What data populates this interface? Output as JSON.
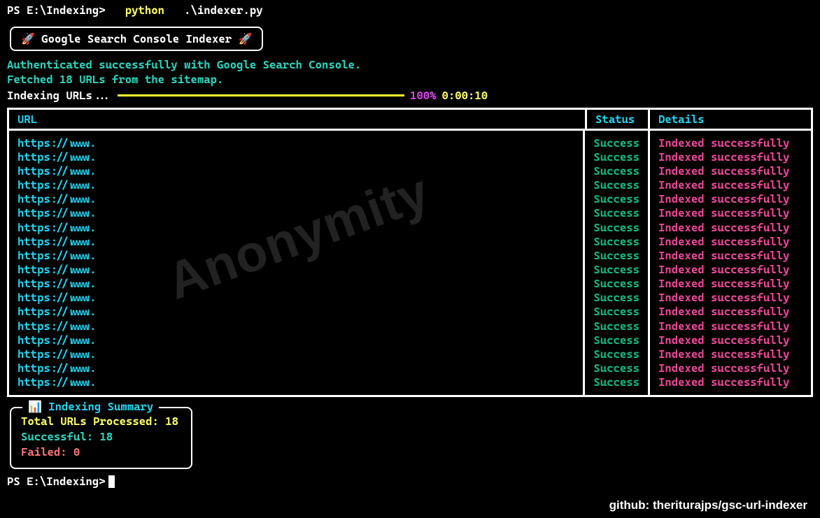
{
  "prompt": {
    "prefix": "PS E:\\Indexing>",
    "command": "python",
    "arg": ".\\indexer.py"
  },
  "title": "Google Search Console Indexer",
  "auth_lines": {
    "line1": "Authenticated successfully with Google Search Console.",
    "line2": "Fetched 18 URLs from the sitemap."
  },
  "progress": {
    "label": "Indexing URLs...",
    "percent": "100%",
    "time": "0:00:10"
  },
  "table": {
    "headers": {
      "url": "URL",
      "status": "Status",
      "details": "Details"
    },
    "rows": [
      {
        "url": "https://www.",
        "status": "Success",
        "details": "Indexed successfully"
      },
      {
        "url": "https://www.",
        "status": "Success",
        "details": "Indexed successfully"
      },
      {
        "url": "https://www.",
        "status": "Success",
        "details": "Indexed successfully"
      },
      {
        "url": "https://www.",
        "status": "Success",
        "details": "Indexed successfully"
      },
      {
        "url": "https://www.",
        "status": "Success",
        "details": "Indexed successfully"
      },
      {
        "url": "https://www.",
        "status": "Success",
        "details": "Indexed successfully"
      },
      {
        "url": "https://www.",
        "status": "Success",
        "details": "Indexed successfully"
      },
      {
        "url": "https://www.",
        "status": "Success",
        "details": "Indexed successfully"
      },
      {
        "url": "https://www.",
        "status": "Success",
        "details": "Indexed successfully"
      },
      {
        "url": "https://www.",
        "status": "Success",
        "details": "Indexed successfully"
      },
      {
        "url": "https://www.",
        "status": "Success",
        "details": "Indexed successfully"
      },
      {
        "url": "https://www.",
        "status": "Success",
        "details": "Indexed successfully"
      },
      {
        "url": "https://www.",
        "status": "Success",
        "details": "Indexed successfully"
      },
      {
        "url": "https://www.",
        "status": "Success",
        "details": "Indexed successfully"
      },
      {
        "url": "https://www.",
        "status": "Success",
        "details": "Indexed successfully"
      },
      {
        "url": "https://www.",
        "status": "Success",
        "details": "Indexed successfully"
      },
      {
        "url": "https://www.",
        "status": "Success",
        "details": "Indexed successfully"
      },
      {
        "url": "https://www.",
        "status": "Success",
        "details": "Indexed successfully"
      }
    ]
  },
  "watermark": "Anonymity",
  "summary": {
    "title": "Indexing Summary",
    "total": "Total URLs Processed: 18",
    "success": "Successful: 18",
    "failed": "Failed: 0"
  },
  "final_prompt": "PS E:\\Indexing>",
  "credit": "github: theriturajps/gsc-url-indexer"
}
